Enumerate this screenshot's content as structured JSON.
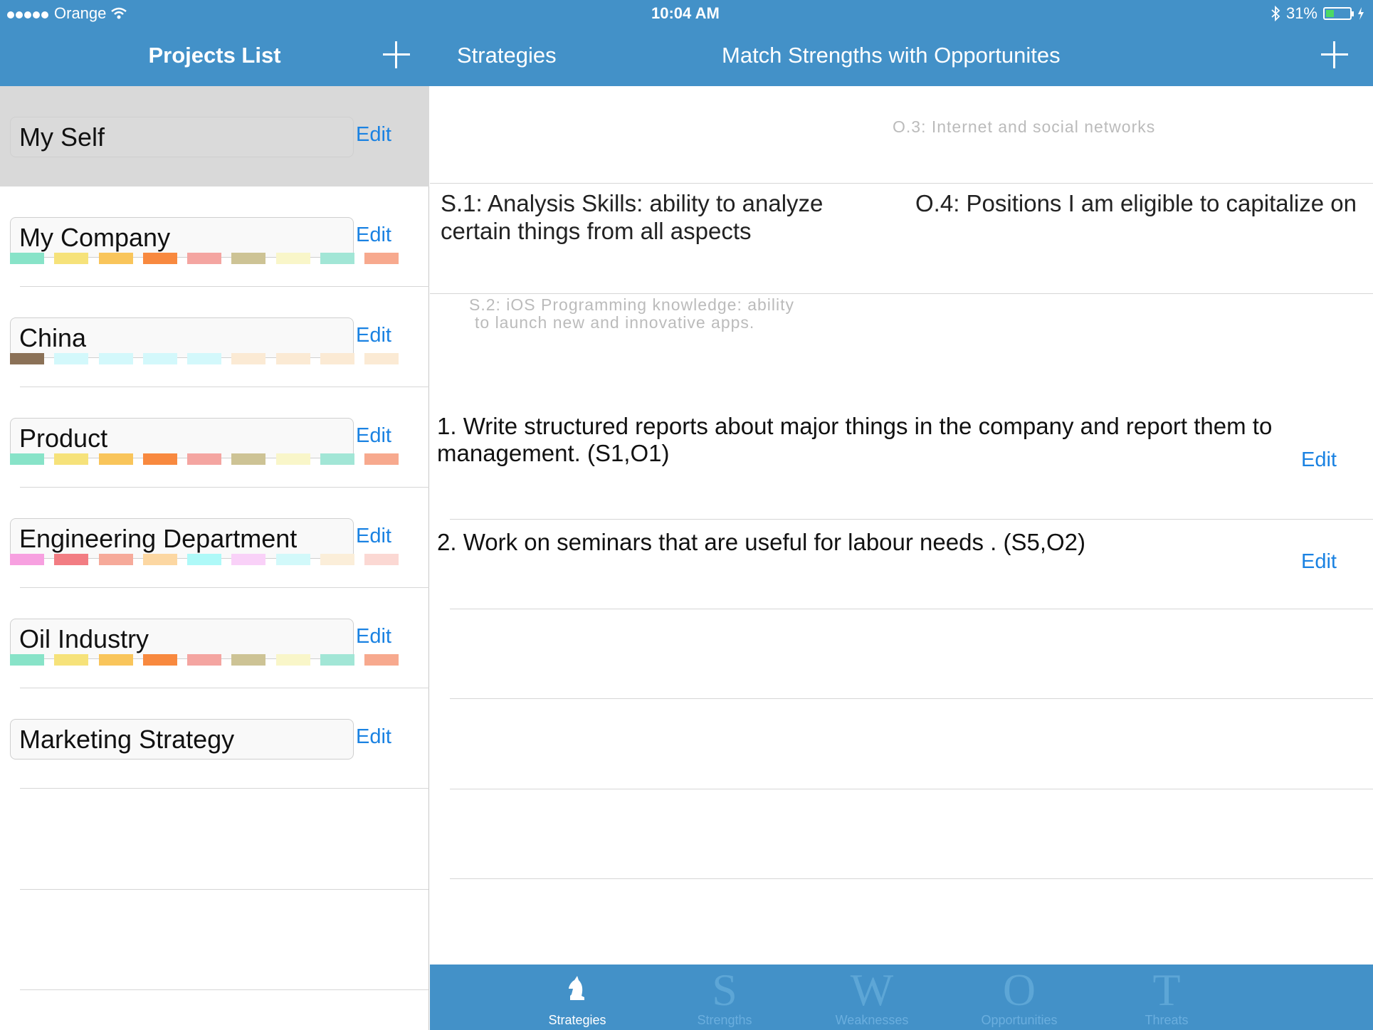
{
  "status_bar": {
    "carrier": "Orange",
    "time": "10:04 AM",
    "battery": "31%"
  },
  "left_nav": {
    "title": "Projects List"
  },
  "right_nav": {
    "back_label": "Strategies",
    "title": "Match Strengths with Opportunites"
  },
  "projects": [
    {
      "name": "My Self",
      "edit": "Edit",
      "selected": true,
      "swatches": []
    },
    {
      "name": "My Company",
      "edit": "Edit",
      "swatches": [
        "#88e3c8",
        "#f6e27a",
        "#f9c55b",
        "#f8893f",
        "#f4a5a1",
        "#cdc395",
        "#f9f6c9",
        "#a2e6d6",
        "#f7a98e"
      ]
    },
    {
      "name": "China",
      "edit": "Edit",
      "swatches": [
        "#8b7157",
        "#d3f8fb",
        "#d3f8fb",
        "#d3f8fb",
        "#d3f8fb",
        "#fbead4",
        "#fbead4",
        "#fbead4",
        "#fbead4"
      ]
    },
    {
      "name": "Product",
      "edit": "Edit",
      "swatches": [
        "#88e3c8",
        "#f6e27a",
        "#f9c55b",
        "#f8893f",
        "#f4a5a1",
        "#cdc395",
        "#f9f6c9",
        "#a2e6d6",
        "#f7a98e"
      ]
    },
    {
      "name": "Engineering Department",
      "edit": "Edit",
      "swatches": [
        "#f7a0e0",
        "#f27d83",
        "#f6aa9a",
        "#fcd7a2",
        "#aef9f8",
        "#f9d1f8",
        "#d2f9fa",
        "#fbeed9",
        "#fbd8d3"
      ]
    },
    {
      "name": "Oil Industry",
      "edit": "Edit",
      "swatches": [
        "#88e3c8",
        "#f6e27a",
        "#f9c55b",
        "#f8893f",
        "#f4a5a1",
        "#cdc395",
        "#f9f6c9",
        "#a2e6d6",
        "#f7a98e"
      ]
    },
    {
      "name": "Marketing Strategy",
      "edit": "Edit",
      "swatches": []
    }
  ],
  "matching": {
    "ghost_opportunity": "O.3: Internet and social networks",
    "strength_selected": "S.1: Analysis Skills: ability to analyze certain things from all aspects",
    "opportunity_selected": "O.4: Positions I am eligible to capitalize on",
    "ghost_strength_line1": "S.2: iOS Programming knowledge: ability",
    "ghost_strength_line2": "to launch new and innovative apps."
  },
  "strategies": [
    {
      "text": "1. Write structured reports about major things in the company and report them to management. (S1,O1)",
      "edit": "Edit"
    },
    {
      "text": "2. Work on seminars that are useful for labour needs . (S5,O2)",
      "edit": "Edit"
    }
  ],
  "tabs": [
    {
      "glyph": "",
      "label": "Strategies",
      "active": true
    },
    {
      "glyph": "S",
      "label": "Strengths"
    },
    {
      "glyph": "W",
      "label": "Weaknesses"
    },
    {
      "glyph": "O",
      "label": "Opportunities"
    },
    {
      "glyph": "T",
      "label": "Threats"
    }
  ],
  "colors": {
    "accent": "#4391c8",
    "link": "#1a82e2",
    "selected_row": "#d9d9d9"
  }
}
